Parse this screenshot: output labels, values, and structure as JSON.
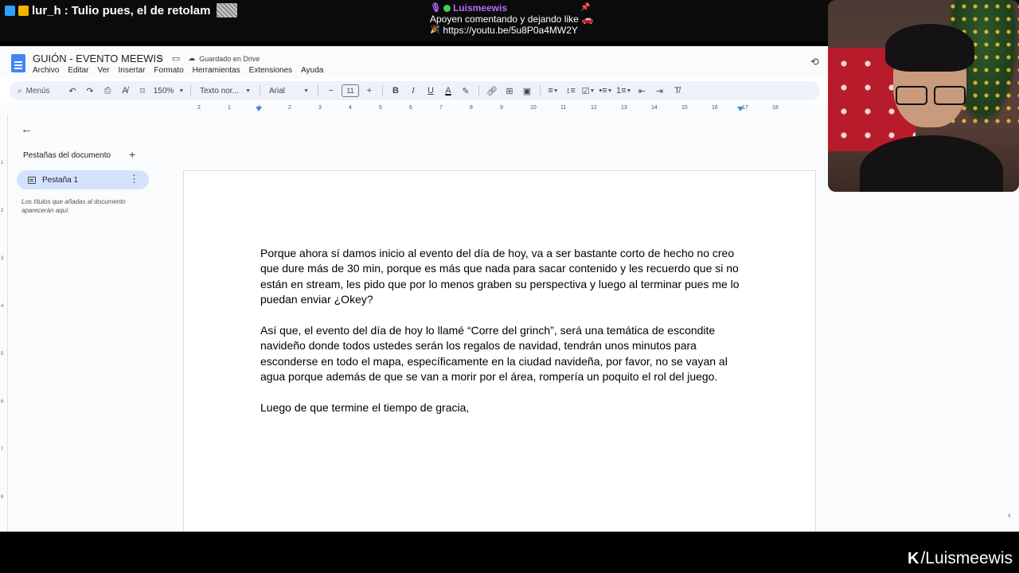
{
  "stream": {
    "chat": {
      "username": "lur_h",
      "separator": ":",
      "message": "Tulio pues, el de retolam",
      "emote_label": "xddddd"
    },
    "pinned": {
      "user": "Luismeewis",
      "line1": "Apoyen comentando y dejando like",
      "link": "https://youtu.be/5u8P0a4MW2Y"
    },
    "brand": {
      "mark": "K",
      "handle": "/Luismeewis"
    }
  },
  "doc": {
    "title": "GUIÓN - EVENTO MEEWIS",
    "saved_status": "Guardado en Drive",
    "menu": [
      "Archivo",
      "Editar",
      "Ver",
      "Insertar",
      "Formato",
      "Herramientas",
      "Extensiones",
      "Ayuda"
    ],
    "toolbar": {
      "search_label": "Menús",
      "zoom": "150%",
      "style": "Texto nor...",
      "font": "Arial",
      "size": "11"
    },
    "ruler_ticks": [
      "2",
      "1",
      "1",
      "2",
      "3",
      "4",
      "5",
      "6",
      "7",
      "8",
      "9",
      "10",
      "11",
      "12",
      "13",
      "14",
      "15",
      "16",
      "17",
      "18"
    ],
    "side_panel": {
      "title": "Pestañas del documento",
      "tab_label": "Pestaña 1",
      "hint": "Los títulos que añadas al documento aparecerán aquí."
    },
    "paragraphs": [
      "Porque ahora sí damos inicio al evento del día de hoy, va a ser bastante corto de hecho no creo que dure más de 30 min, porque es más que nada para sacar contenido y les recuerdo que si no están en stream, les pido que por lo menos graben su perspectiva y luego al terminar pues me lo puedan enviar ¿Okey?",
      "Así que, el evento del día de hoy lo llamé “Corre del grinch”, será una temática de escondite navideño donde todos ustedes serán los regalos de navidad, tendrán unos minutos para esconderse en todo el mapa, específicamente en la ciudad navideña, por favor, no se vayan al agua porque además de que se van a morir por el área, rompería un poquito el rol del juego.",
      "Luego de que termine el tiempo de gracia,"
    ]
  },
  "colors": {
    "accent": "#4285f4",
    "tab_bg": "#d3e3fd",
    "toolbar_bg": "#edf2fa",
    "pinned_user": "#b46cff"
  }
}
